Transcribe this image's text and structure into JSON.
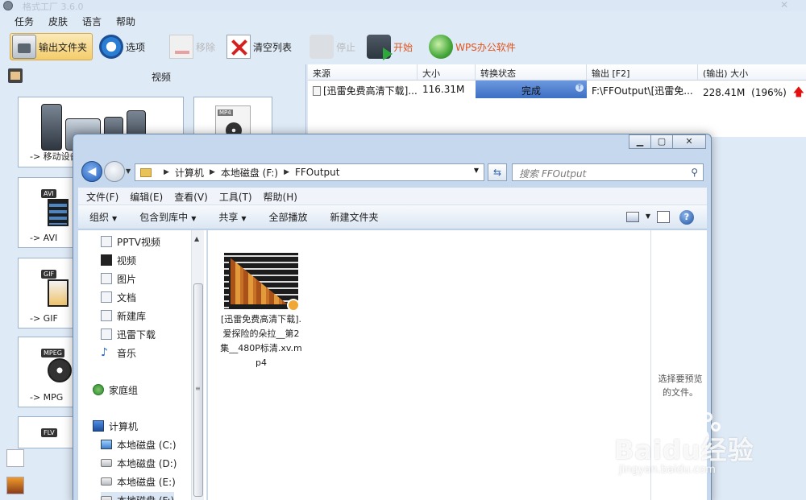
{
  "app": {
    "title": "格式工厂 3.6.0",
    "menu": [
      "任务",
      "皮肤",
      "语言",
      "帮助"
    ],
    "toolbar": {
      "output_folder": "输出文件夹",
      "options": "选项",
      "remove": "移除",
      "clear_list": "清空列表",
      "stop": "停止",
      "start": "开始",
      "wps": "WPS办公软件"
    },
    "left_panel": {
      "title": "视频",
      "tiles": [
        "-> 移动设备",
        "-> AVI",
        "-> GIF",
        "-> MPG"
      ],
      "tags": [
        "MP4",
        "AVI",
        "GIF",
        "MPEG",
        "FLV"
      ]
    },
    "task_list": {
      "columns": [
        "来源",
        "大小",
        "转换状态",
        "输出 [F2]",
        "(输出) 大小"
      ],
      "rows": [
        {
          "source": "[迅雷免费高清下载]....",
          "size": "116.31M",
          "status": "完成",
          "output": "F:\\FFOutput\\[迅雷免...",
          "output_size": "228.41M",
          "percent": "(196%)"
        }
      ]
    }
  },
  "explorer": {
    "address": [
      "计算机",
      "本地磁盘 (F:)",
      "FFOutput"
    ],
    "search_placeholder": "搜索 FFOutput",
    "menu": [
      "文件(F)",
      "编辑(E)",
      "查看(V)",
      "工具(T)",
      "帮助(H)"
    ],
    "commands": [
      "组织",
      "包含到库中",
      "共享",
      "全部播放",
      "新建文件夹"
    ],
    "nav": {
      "libraries": [
        "PPTV视频",
        "视频",
        "图片",
        "文档",
        "新建库",
        "迅雷下载",
        "音乐"
      ],
      "homegroup": "家庭组",
      "computer": "计算机",
      "drives": [
        "本地磁盘 (C:)",
        "本地磁盘 (D:)",
        "本地磁盘 (E:)",
        "本地磁盘 (F:)"
      ]
    },
    "file": {
      "name": "[迅雷免费高清下载].爱探险的朵拉__第2集__480P标清.xv.mp4"
    },
    "preview_message": "选择要预览的文件。"
  },
  "watermark": {
    "text": "Baidu经验",
    "url": "jingyan.baidu.com"
  }
}
